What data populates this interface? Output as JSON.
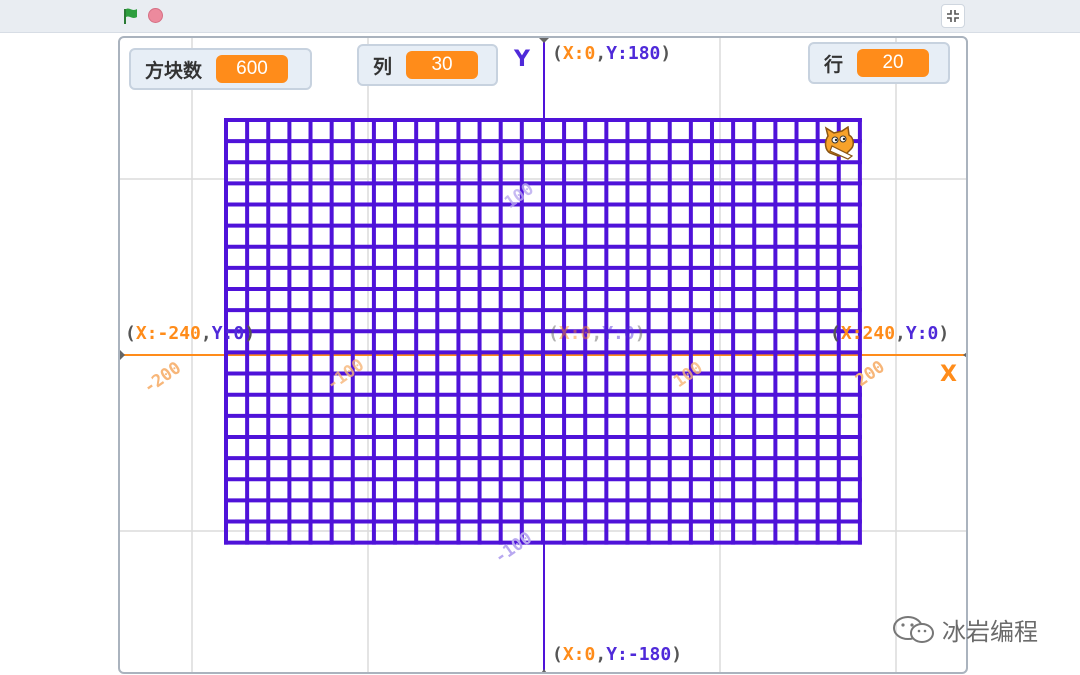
{
  "toolbar": {
    "flag_color": "#2e9e3e",
    "stop_color": "#ec8a9d",
    "fullscreen_icon": "fullscreen-exit-icon"
  },
  "monitors": {
    "blocks": {
      "label": "方块数",
      "value": "600"
    },
    "cols": {
      "label": "列",
      "value": "30"
    },
    "rows": {
      "label": "行",
      "value": "20"
    }
  },
  "coords": {
    "top": {
      "open": "(",
      "xk": "X:0",
      "comma": ",",
      "yk": "Y:180",
      "close": ")"
    },
    "bottom": {
      "open": "(",
      "xk": "X:0",
      "comma": ",",
      "yk": "Y:-180",
      "close": ")"
    },
    "left": {
      "open": "(",
      "xk": "X:-240",
      "comma": ",",
      "yk": "Y:0",
      "close": ")"
    },
    "right": {
      "open": "(",
      "xk": "X:240",
      "comma": ",",
      "yk": "Y:0",
      "close": ")"
    },
    "center": {
      "open": "(",
      "xk": "X:0",
      "comma": ",",
      "yk": "Y:0",
      "close": ")"
    }
  },
  "axes": {
    "x_letter": "X",
    "y_letter": "Y",
    "x_ticks": [
      "-200",
      "-100",
      "100",
      "200"
    ],
    "y_ticks": [
      "100",
      "-100"
    ],
    "x_color": "#ff8c1a",
    "y_color": "#4f2ad9"
  },
  "grid": {
    "columns": 30,
    "rows": 20,
    "line_color": "#4f12d9"
  },
  "sprite": {
    "icon": "scratch-cat-icon"
  },
  "watermark": {
    "text": "冰岩编程",
    "icon": "wechat-icon"
  }
}
